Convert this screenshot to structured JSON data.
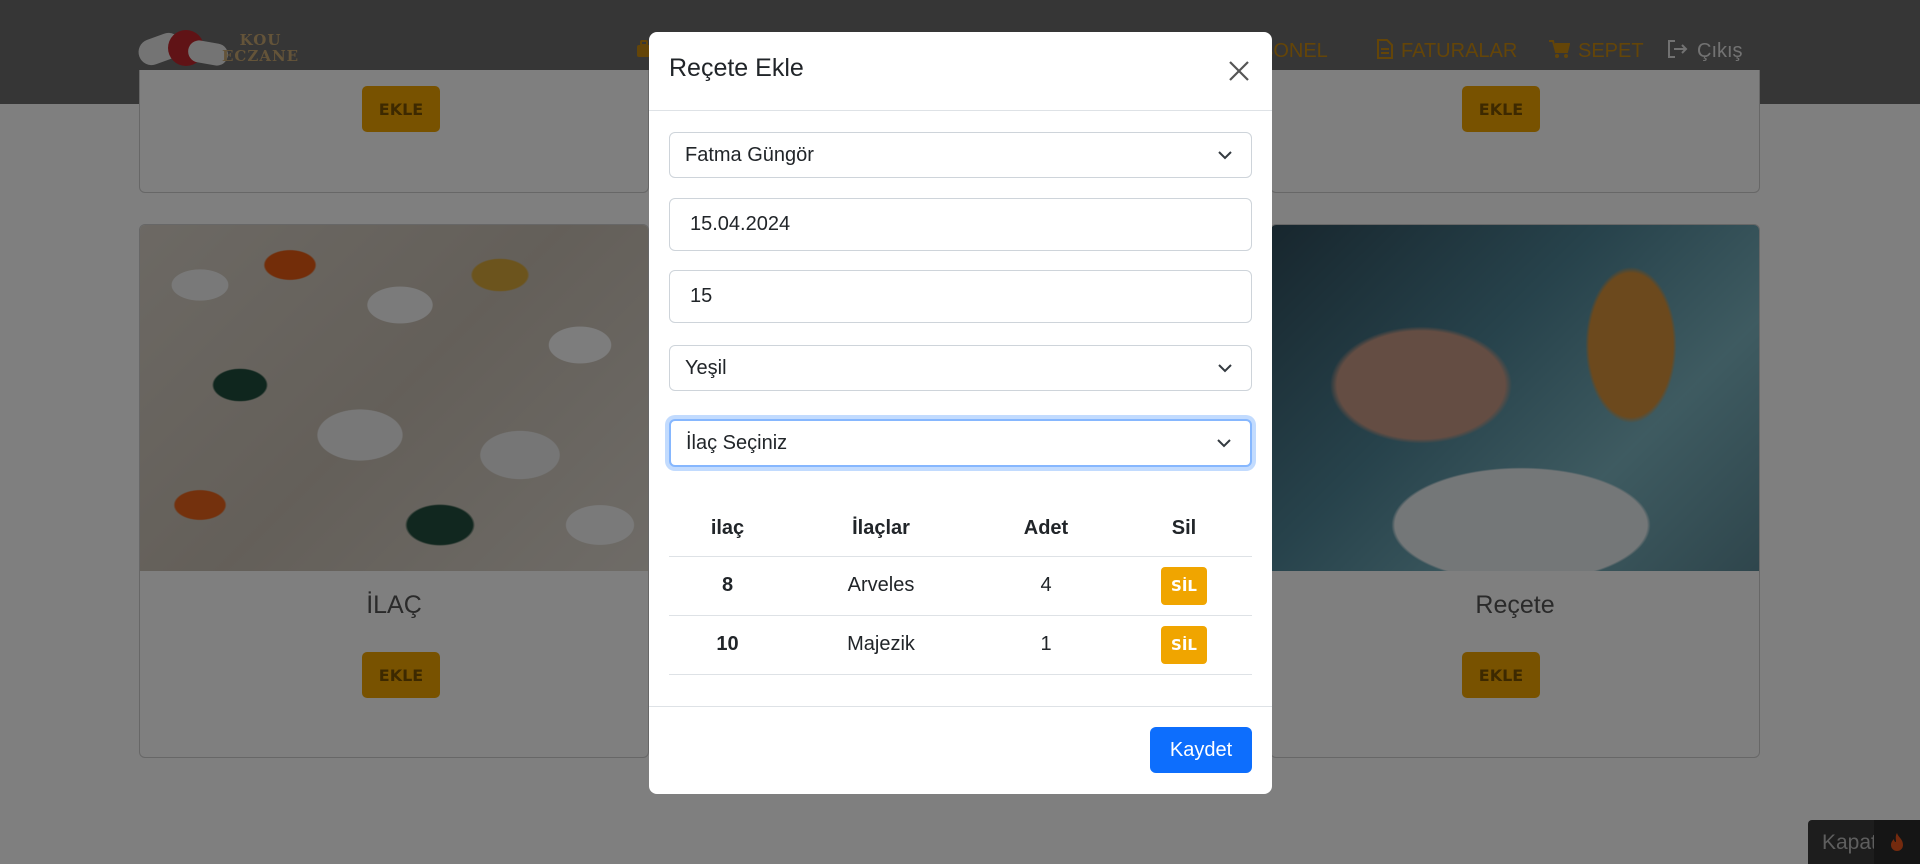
{
  "navbar": {
    "logo_text_top": "KOU",
    "logo_text_bottom": "ECZANE",
    "links": [
      {
        "label": "SONEL",
        "icon": "user-icon"
      },
      {
        "label": "FATURALAR",
        "icon": "file-icon"
      },
      {
        "label": "SEPET",
        "icon": "cart-icon"
      },
      {
        "label": "Çıkış",
        "icon": "sign-out-icon"
      }
    ],
    "colors": {
      "background": "#6c6c6c",
      "link": "#c98a10"
    }
  },
  "cards": {
    "top_left_button": "EKLE",
    "top_right_button": "EKLE",
    "left": {
      "title": "İLAÇ",
      "button": "EKLE"
    },
    "right": {
      "title": "Reçete",
      "button": "EKLE"
    }
  },
  "modal": {
    "title": "Reçete Ekle",
    "patient_select": "Fatma Güngör",
    "date_value": "15.04.2024",
    "quantity_value": "15",
    "color_select": "Yeşil",
    "drug_select": "İlaç Seçiniz",
    "table": {
      "headers": [
        "ilaç",
        "İlaçlar",
        "Adet",
        "Sil"
      ],
      "rows": [
        {
          "id": "8",
          "name": "Arveles",
          "count": "4",
          "action": "SİL"
        },
        {
          "id": "10",
          "name": "Majezik",
          "count": "1",
          "action": "SİL"
        }
      ]
    },
    "save_label": "Kaydet",
    "colors": {
      "primary": "#0d6efd",
      "warning": "#f0a500"
    }
  },
  "floating": {
    "close_label": "Kapat"
  }
}
